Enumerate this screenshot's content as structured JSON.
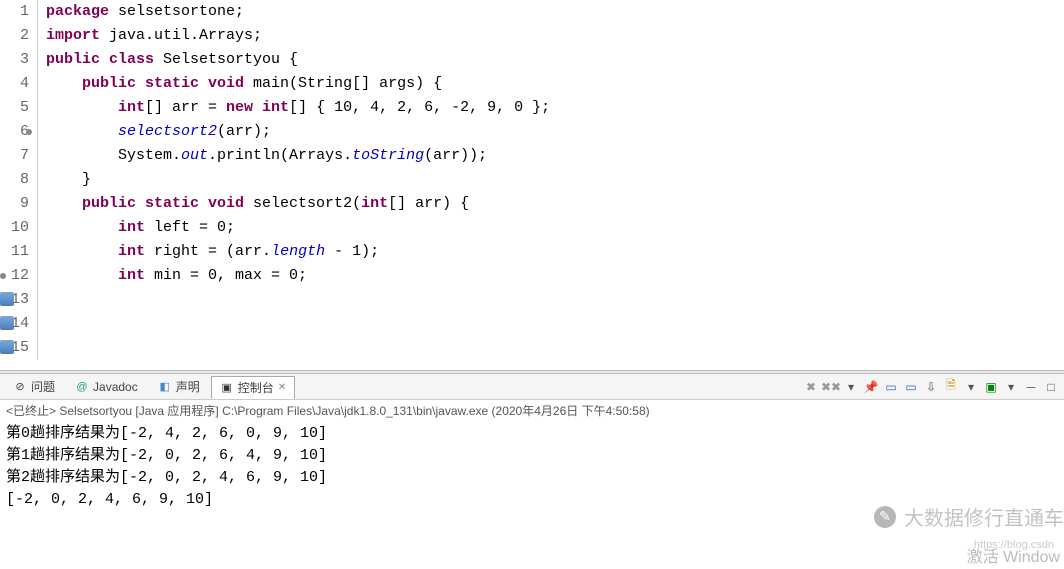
{
  "code": {
    "lines": [
      {
        "n": "1",
        "marked": false,
        "circle": false,
        "tokens": [
          [
            "kw",
            "package"
          ],
          [
            "",
            " selsetsortone;"
          ]
        ]
      },
      {
        "n": "2",
        "marked": false,
        "circle": false,
        "tokens": [
          [
            "",
            ""
          ]
        ]
      },
      {
        "n": "3",
        "marked": false,
        "circle": false,
        "tokens": [
          [
            "kw",
            "import"
          ],
          [
            "",
            " java.util.Arrays;"
          ]
        ]
      },
      {
        "n": "4",
        "marked": false,
        "circle": false,
        "tokens": [
          [
            "",
            ""
          ]
        ]
      },
      {
        "n": "5",
        "marked": false,
        "circle": false,
        "tokens": [
          [
            "kw",
            "public class"
          ],
          [
            "",
            " Selsetsortyou {"
          ]
        ]
      },
      {
        "n": "6",
        "marked": false,
        "circle": true,
        "tokens": [
          [
            "",
            "    "
          ],
          [
            "kw",
            "public static void"
          ],
          [
            "",
            " main(String[] args) {"
          ]
        ]
      },
      {
        "n": "7",
        "marked": false,
        "circle": false,
        "tokens": [
          [
            "",
            "        "
          ],
          [
            "kw",
            "int"
          ],
          [
            "",
            "[] arr = "
          ],
          [
            "kw",
            "new int"
          ],
          [
            "",
            "[] { 10, 4, 2, 6, -2, 9, 0 };"
          ]
        ]
      },
      {
        "n": "8",
        "marked": false,
        "circle": false,
        "tokens": [
          [
            "",
            "        "
          ],
          [
            "fld",
            "selectsort2"
          ],
          [
            "",
            "(arr);"
          ]
        ]
      },
      {
        "n": "9",
        "marked": false,
        "circle": false,
        "tokens": [
          [
            "",
            "        System."
          ],
          [
            "fld",
            "out"
          ],
          [
            "",
            ".println(Arrays."
          ],
          [
            "fld",
            "toString"
          ],
          [
            "",
            "(arr));"
          ]
        ]
      },
      {
        "n": "10",
        "marked": false,
        "circle": false,
        "tokens": [
          [
            "",
            "    }"
          ]
        ]
      },
      {
        "n": "11",
        "marked": false,
        "circle": false,
        "tokens": [
          [
            "",
            ""
          ]
        ]
      },
      {
        "n": "12",
        "marked": true,
        "circle": true,
        "tokens": [
          [
            "",
            "    "
          ],
          [
            "kw",
            "public static void"
          ],
          [
            "",
            " selectsort2("
          ],
          [
            "kw",
            "int"
          ],
          [
            "",
            "[] arr) {"
          ]
        ]
      },
      {
        "n": "13",
        "marked": true,
        "circle": false,
        "tokens": [
          [
            "",
            "        "
          ],
          [
            "kw",
            "int"
          ],
          [
            "",
            " left = 0;"
          ]
        ]
      },
      {
        "n": "14",
        "marked": true,
        "circle": false,
        "tokens": [
          [
            "",
            "        "
          ],
          [
            "kw",
            "int"
          ],
          [
            "",
            " right = (arr."
          ],
          [
            "fld",
            "length"
          ],
          [
            "",
            " - 1);"
          ]
        ]
      },
      {
        "n": "15",
        "marked": true,
        "circle": false,
        "tokens": [
          [
            "",
            "        "
          ],
          [
            "kw",
            "int"
          ],
          [
            "",
            " min = 0, max = 0;"
          ]
        ]
      }
    ]
  },
  "tabs": {
    "problems": "问题",
    "javadoc": "Javadoc",
    "declaration": "声明",
    "console": "控制台"
  },
  "status": "<已终止> Selsetsortyou [Java 应用程序] C:\\Program Files\\Java\\jdk1.8.0_131\\bin\\javaw.exe  (2020年4月26日 下午4:50:58)",
  "console_output": [
    "第0趟排序结果为[-2, 4, 2, 6, 0, 9, 10]",
    "第1趟排序结果为[-2, 0, 2, 6, 4, 9, 10]",
    "第2趟排序结果为[-2, 0, 2, 4, 6, 9, 10]",
    "[-2, 0, 2, 4, 6, 9, 10]"
  ],
  "watermark": {
    "text": "大数据修行直通车",
    "sub": "https://blog.csdn",
    "activate": "激活 Window"
  },
  "toolbar_icons": [
    "x-remove",
    "x-stop",
    "pin",
    "screen",
    "screen-alt",
    "arrow-down",
    "lock",
    "clear",
    "min",
    "max"
  ]
}
